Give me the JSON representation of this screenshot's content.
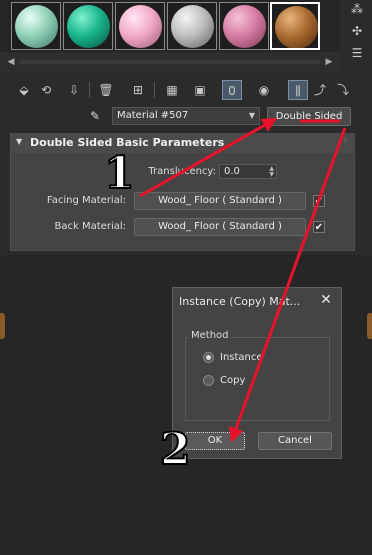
{
  "slots": [
    {
      "name": "slot-1",
      "color": "#8fcfb6",
      "active": false
    },
    {
      "name": "slot-2",
      "color": "#19b48c",
      "active": false
    },
    {
      "name": "slot-3",
      "color": "#f2aac8",
      "active": false
    },
    {
      "name": "slot-4",
      "color": "#bdbdbd",
      "active": false
    },
    {
      "name": "slot-5",
      "color": "#d67ba2",
      "active": false
    },
    {
      "name": "slot-6",
      "color": "#a8692f",
      "active": true
    }
  ],
  "toolbar": {
    "map_channel": "0"
  },
  "material": {
    "name": "Material #507",
    "type_button": "Double Sided"
  },
  "rollout": {
    "title": "Double Sided Basic Parameters",
    "translucency_label": "Translucency:",
    "translucency_value": "0.0",
    "facing_label": "Facing Material:",
    "facing_value": "Wood_ Floor  ( Standard )",
    "back_label": "Back Material:",
    "back_value": "Wood_ Floor  ( Standard )"
  },
  "dialog": {
    "title": "Instance (Copy) Mat...",
    "close_glyph": "✕",
    "group_label": "Method",
    "options": [
      "Instance",
      "Copy"
    ],
    "selected_option": "Instance",
    "ok_label": "OK",
    "cancel_label": "Cancel"
  },
  "annotations": {
    "step1": "1",
    "step2": "2",
    "arrow_color": "#e8132a"
  }
}
